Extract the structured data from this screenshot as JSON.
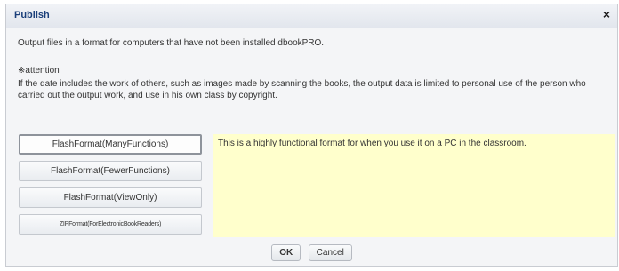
{
  "window": {
    "title": "Publish",
    "close_glyph": "×"
  },
  "description": "Output files in a format for computers that have not been installed dbookPRO.",
  "attention": {
    "title": "※attention",
    "body": "If the date includes the work of others, such as images made by scanning the books, the output data is limited to personal use of the person who carried out the output work, and use in his own class by copyright."
  },
  "formats": [
    {
      "label": "FlashFormat(ManyFunctions)",
      "selected": true
    },
    {
      "label": "FlashFormat(FewerFunctions)",
      "selected": false
    },
    {
      "label": "FlashFormat(ViewOnly)",
      "selected": false
    },
    {
      "label": "ZIPFormat(ForElectronicBookReaders)",
      "selected": false
    }
  ],
  "format_description": "This is a highly functional format for when you use it on a PC in the classroom.",
  "buttons": {
    "ok": "OK",
    "cancel": "Cancel"
  },
  "colors": {
    "title_text": "#1a3f7a",
    "description_panel": "#ffffcc"
  }
}
